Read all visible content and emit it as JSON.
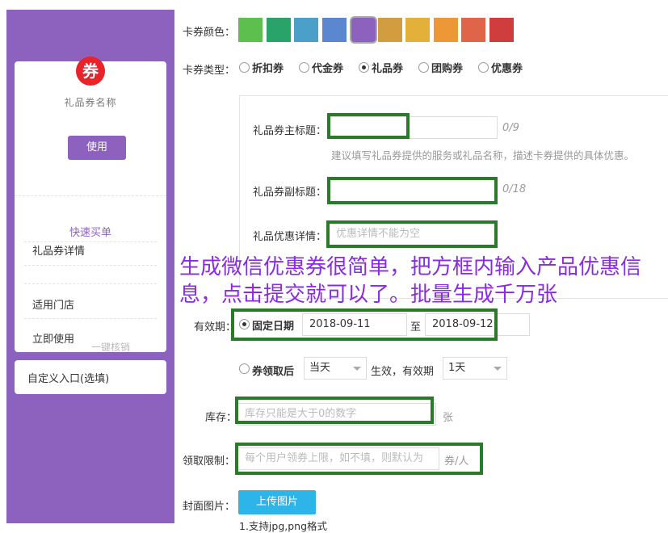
{
  "preview": {
    "coupon_icon": "券",
    "card_title": "礼品券名称",
    "use_button": "使用",
    "quick_buy": "快速买单",
    "menu": [
      "礼品券详情",
      "适用门店",
      "立即使用"
    ],
    "one_key": "一键核销",
    "custom_entry": "自定义入口(选填)"
  },
  "form": {
    "color_label": "卡券颜色：",
    "colors": [
      "#5dbf4d",
      "#2aa36a",
      "#4aa0c8",
      "#5b86d0",
      "#8d62bf",
      "#d29d3e",
      "#e3b03a",
      "#ee9737",
      "#e06447",
      "#cf3e3c"
    ],
    "selected_color_index": 4,
    "type_label": "卡券类型：",
    "types": [
      "折扣券",
      "代金券",
      "礼品券",
      "团购券",
      "优惠券"
    ],
    "selected_type": "礼品券",
    "main_title_label": "礼品券主标题：",
    "main_title_value": "",
    "main_title_counter": "0/9",
    "main_title_hint": "建议填写礼品券提供的服务或礼品名称，描述卡券提供的具体优惠。",
    "sub_title_label": "礼品券副标题：",
    "sub_title_counter": "0/18",
    "detail_label": "礼品优惠详情：",
    "detail_placeholder": "优惠详情不能为空",
    "validity_label": "有效期：",
    "fixed_date_label": "固定日期",
    "start_date": "2018-09-11",
    "to_label": "至",
    "end_date": "2018-09-12",
    "after_receive_label": "券领取后",
    "after_receive_select": "当天",
    "effective_text": "生效，有效期",
    "duration_select": "1天",
    "stock_label": "库存：",
    "stock_placeholder": "库存只能是大于0的数字",
    "stock_unit": "张",
    "limit_label": "领取限制：",
    "limit_placeholder": "每个用户领券上限，如不填，则默认为",
    "limit_unit": "券/人",
    "cover_label": "封面图片：",
    "upload_button": "上传图片",
    "upload_hint": "1.支持jpg,png格式"
  },
  "overlay_text": "生成微信优惠券很简单，把方框内输入产品优惠信息，点击提交就可以了。批量生成千万张"
}
